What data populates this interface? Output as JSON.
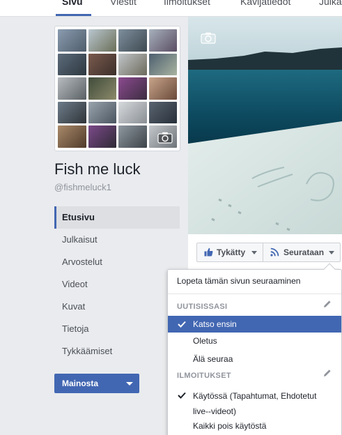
{
  "tabs": [
    {
      "label": "Sivu",
      "active": true
    },
    {
      "label": "Viestit",
      "active": false
    },
    {
      "label": "Ilmoitukset",
      "active": false
    },
    {
      "label": "Kävijätiedot",
      "active": false
    },
    {
      "label": "Julka",
      "active": false
    }
  ],
  "page": {
    "name": "Fish me luck",
    "handle": "@fishmeluck1"
  },
  "nav": {
    "items": [
      {
        "label": "Etusivu",
        "active": true
      },
      {
        "label": "Julkaisut",
        "active": false
      },
      {
        "label": "Arvostelut",
        "active": false
      },
      {
        "label": "Videot",
        "active": false
      },
      {
        "label": "Kuvat",
        "active": false
      },
      {
        "label": "Tietoja",
        "active": false
      },
      {
        "label": "Tykkäämiset",
        "active": false
      }
    ],
    "promote_label": "Mainosta"
  },
  "actions": {
    "like_label": "Tykätty",
    "follow_label": "Seurataan"
  },
  "menu": {
    "unfollow_label": "Lopeta tämän sivun seuraaminen",
    "newsfeed_header": "UUTISISSASI",
    "newsfeed_options": [
      {
        "label": "Katso ensin",
        "selected": true
      },
      {
        "label": "Oletus",
        "selected": false
      },
      {
        "label": "Älä seuraa",
        "selected": false
      }
    ],
    "notifications_header": "ILMOITUKSET",
    "notifications_on_label_line1": "Käytössä (Tapahtumat, Ehdotetut",
    "notifications_on_label_line2": "live--videot)",
    "notifications_off_label": "Kaikki pois käytöstä"
  },
  "colors": {
    "brand": "#4267b2",
    "background": "#e9ebee"
  },
  "icons": [
    "camera-icon",
    "thumbs-up-icon",
    "rss-icon",
    "check-icon",
    "pencil-icon",
    "chevron-down-icon"
  ]
}
